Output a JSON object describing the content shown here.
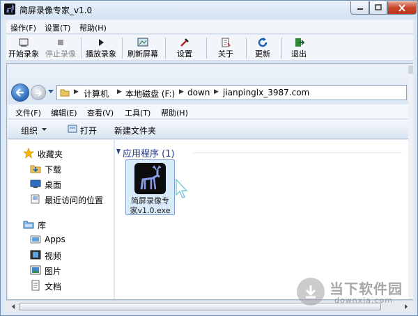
{
  "window": {
    "title": "简屏录像专家_v1.0"
  },
  "menubar": {
    "items": [
      "操作(F)",
      "设置(T)",
      "帮助(H)"
    ]
  },
  "toolbar": {
    "buttons": [
      {
        "label": "开始录象",
        "icon": "record-icon",
        "enabled": true
      },
      {
        "label": "停止录像",
        "icon": "stop-icon",
        "enabled": false
      },
      {
        "label": "播放录象",
        "icon": "play-icon",
        "enabled": true
      },
      {
        "label": "刷新屏幕",
        "icon": "refresh-screen-icon",
        "enabled": true
      },
      {
        "label": "设置",
        "icon": "settings-tools-icon",
        "enabled": true
      },
      {
        "label": "关于",
        "icon": "about-icon",
        "enabled": true
      },
      {
        "label": "更新",
        "icon": "update-icon",
        "enabled": true
      },
      {
        "label": "退出",
        "icon": "exit-icon",
        "enabled": true
      }
    ]
  },
  "explorer": {
    "breadcrumb": [
      "计算机",
      "本地磁盘 (F:)",
      "down",
      "jianpinglx_3987.com"
    ],
    "menu": [
      "文件(F)",
      "编辑(E)",
      "查看(V)",
      "工具(T)",
      "帮助(H)"
    ],
    "commands": {
      "organize": "组织",
      "open": "打开",
      "new_folder": "新建文件夹"
    },
    "nav": {
      "favorites": "收藏夹",
      "downloads": "下载",
      "desktop": "桌面",
      "recent": "最近访问的位置",
      "libraries": "库",
      "apps": "Apps",
      "videos": "视频",
      "pictures": "图片",
      "documents": "文档"
    },
    "group": {
      "heading": "应用程序 (1)"
    },
    "file": {
      "name_line1": "简屏录像专",
      "name_line2": "家v1.0.exe",
      "icon": "deer-app-icon"
    }
  },
  "watermark": {
    "text": "当下软件园",
    "url": "downxia.com"
  },
  "colors": {
    "window_frame": "#dfe9f5",
    "group_heading": "#1e3287",
    "selected_tile": "#d9ebfb"
  }
}
